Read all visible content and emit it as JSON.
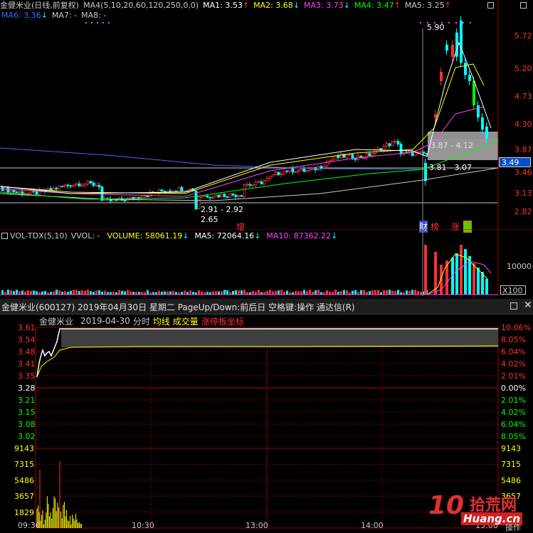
{
  "kline": {
    "stock_name": "金健米业",
    "period_label": "(日线,前复权)",
    "ma_group1": [
      {
        "label": "MA4(5,10,20,60,120,250,0,0)",
        "color": "#c8c8c8"
      },
      {
        "label": "MA1: 3.53",
        "arrow": "↑",
        "color": "#ffffff",
        "arrow_color": "#ff3030"
      },
      {
        "label": "MA2: 3.68",
        "arrow": "↓",
        "color": "#ffff00",
        "arrow_color": "#00ffff"
      },
      {
        "label": "MA3: 3.73",
        "arrow": "↓",
        "color": "#ff40ff",
        "arrow_color": "#00ffff"
      },
      {
        "label": "MA4: 3.47",
        "arrow": "↑",
        "color": "#00ff00",
        "arrow_color": "#ff3030"
      },
      {
        "label": "MA5: 3.25",
        "arrow": "↑",
        "color": "#c8c8c8",
        "arrow_color": "#ff3030"
      }
    ],
    "ma_group2": [
      {
        "label": "MA6: 3.36",
        "arrow": "↓",
        "color": "#3a6bff",
        "arrow_color": "#00ffff"
      },
      {
        "label": "MA7: -",
        "arrow": "",
        "color": "#c8c8c8",
        "arrow_color": "#c8c8c8"
      },
      {
        "label": "MA8: -",
        "arrow": "",
        "color": "#c8c8c8",
        "arrow_color": "#c8c8c8"
      }
    ],
    "price_axis": [
      "5.72",
      "5.20",
      "4.73",
      "4.30",
      "3.87",
      "3.49",
      "3.46",
      "3.13",
      "2.82"
    ],
    "current_price_tag": "3.49",
    "annotations": {
      "high": "5.90",
      "range_box": "3.87 - 4.12",
      "range2": "3.81 - 3.07",
      "low_range": "2.91 - 2.92",
      "low": "2.65"
    },
    "markers": [
      {
        "text": "增",
        "color": "#ff3030"
      },
      {
        "text": "财",
        "color": "#ffffff",
        "bg": "#3050c0"
      },
      {
        "text": "榜",
        "color": "#ff3030"
      },
      {
        "text": "涨",
        "color": "#ff3030"
      },
      {
        "text": "跌",
        "color": "#00ff00",
        "bg": "#c0c000"
      }
    ]
  },
  "volume": {
    "indicator_label": "VOL-TDX(5,10)",
    "vvol": "VVOL: -",
    "volume_label": "VOLUME: 58061.19",
    "volume_arrow": "↓",
    "ma5_label": "MA5: 72064.16",
    "ma5_arrow": "↓",
    "ma10_label": "MA10: 87362.22",
    "ma10_arrow": "↓",
    "axis_label": "10000",
    "unit_label": "X100"
  },
  "intraday": {
    "title_bar": "金健米业(600127) 2019年04月30日 星期二 PageUp/Down:前后日 空格键:操作 通达信(R)",
    "stock_name": "金健米业",
    "date": "2019-04-30",
    "mode": "分时",
    "legend_avg": "均线",
    "legend_vol": "成交量",
    "legend_limit": "涨停板坐标",
    "left_prices": [
      "3.61",
      "3.54",
      "3.48",
      "3.41",
      "3.35",
      "3.28",
      "3.21",
      "3.15",
      "3.08",
      "3.02"
    ],
    "right_pcts": [
      "10.06%",
      "8.05%",
      "6.04%",
      "4.02%",
      "2.01%",
      "0.00%",
      "2.01%",
      "4.02%",
      "6.04%",
      "8.05%"
    ],
    "vol_axis": [
      "9143",
      "7315",
      "5486",
      "3657",
      "1829"
    ],
    "vol_axis_right": [
      "9143",
      "7315",
      "5486",
      "3657"
    ],
    "time_axis": [
      "09:30",
      "10:30",
      "13:00",
      "14:00",
      "15:00"
    ],
    "watermark_num": "10",
    "watermark_cn": "拾荒网",
    "watermark_url": "Huang.cn",
    "operate_label": "操作"
  },
  "colors": {
    "up": "#ff3030",
    "down": "#00ffff",
    "grid": "#800000",
    "bg": "#000000"
  }
}
